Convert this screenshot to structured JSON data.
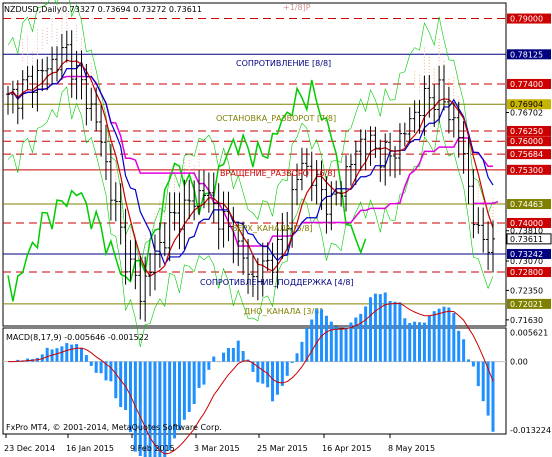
{
  "header": {
    "symbol": "NZDUSD,Daily",
    "ohlc": "0.73327 0.73694 0.73272 0.73611"
  },
  "top_marker": "+1/8]P",
  "current_price": "0.73611",
  "price_labels": [
    "0.79000",
    "0.78125",
    "0.77400",
    "0.76904",
    "0.76702",
    "0.76250",
    "0.76000",
    "0.75684",
    "0.75300",
    "0.74463",
    "0.74000",
    "0.73810",
    "0.73242",
    "0.73070",
    "0.72800",
    "0.72350",
    "0.72021",
    "0.71630"
  ],
  "levels": {
    "resistance": "СОПРОТИВЛЕНИЕ [8/8]",
    "reversal_up": "ОСТАНОВКА_РАЗВОРОТ [7/8]",
    "reversal": "ВРАЩЕНИЕ_РАЗВОРОТ [6/8]",
    "channel_top": "ВЕРХ_КАНАЛА [5/8]",
    "support": "СОПРОТИВЛЕНИЕ_ПОДДЕРЖКА [4/8]",
    "channel_bottom": "ДНО_КАНАЛА [3/8]"
  },
  "macd": {
    "label": "MACD(8,17,9) -0.005646 -0.001522",
    "scale_top": "0.005621",
    "scale_zero": "0.00",
    "scale_bottom": "-0.013224"
  },
  "copyright": "FxPro MT4, © 2001-2014, MetaQuotes Software Corp.",
  "time_labels": [
    "23 Dec 2014",
    "16 Jan 2015",
    "9 Feb 2015",
    "3 Mar 2015",
    "25 Mar 2015",
    "16 Apr 2015",
    "8 May 2015"
  ],
  "colors": {
    "red_line": "#cc0000",
    "blue_line": "#0000cc",
    "magenta_line": "#e000e0",
    "green_line": "#00cc00",
    "olive_line": "#808000",
    "macd_bars": "#1e90ff",
    "macd_signal": "#cc0000"
  }
}
